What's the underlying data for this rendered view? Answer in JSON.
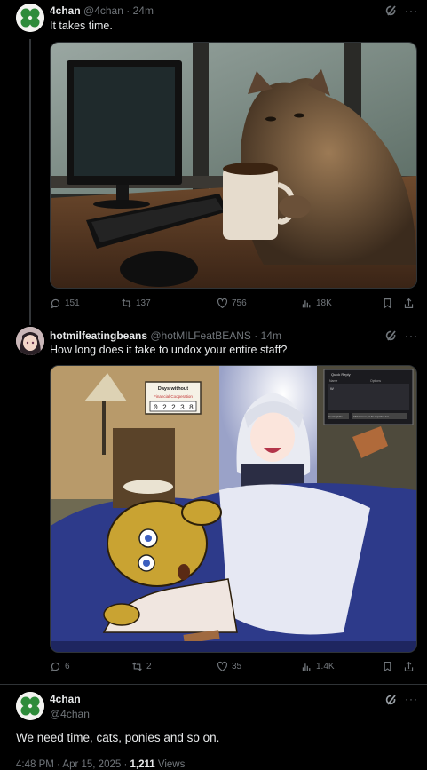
{
  "tweets": [
    {
      "name": "4chan",
      "handle": "@4chan",
      "time": "24m",
      "text": "It takes time.",
      "stats": {
        "replies": "151",
        "reposts": "137",
        "likes": "756",
        "views": "18K"
      }
    },
    {
      "name": "hotmilfeatingbeans",
      "handle": "@hotMILFeatBEANS",
      "time": "14m",
      "text": "How long does it take to undox your entire staff?",
      "stats": {
        "replies": "6",
        "reposts": "2",
        "likes": "35",
        "views": "1.4K"
      },
      "image_text": {
        "sign_title": "Days without",
        "sign_sub": "Financial Cooperation",
        "sign_digits": [
          "0",
          "2",
          "2",
          "3",
          "8"
        ],
        "window_title": "Quick Reply",
        "window_name": "Name",
        "window_options": "Options",
        "window_body": "W",
        "window_btn1": "Get Captcha",
        "window_btn2": "Click Here to get the Captcha Here"
      }
    },
    {
      "name": "4chan",
      "handle": "@4chan",
      "text": "We need time, cats, ponies and so on.",
      "timestamp": "4:48 PM · Apr 15, 2025 · ",
      "views_count": "1,211",
      "views_label": "Views"
    }
  ],
  "separator": "·",
  "more_glyph": "···"
}
